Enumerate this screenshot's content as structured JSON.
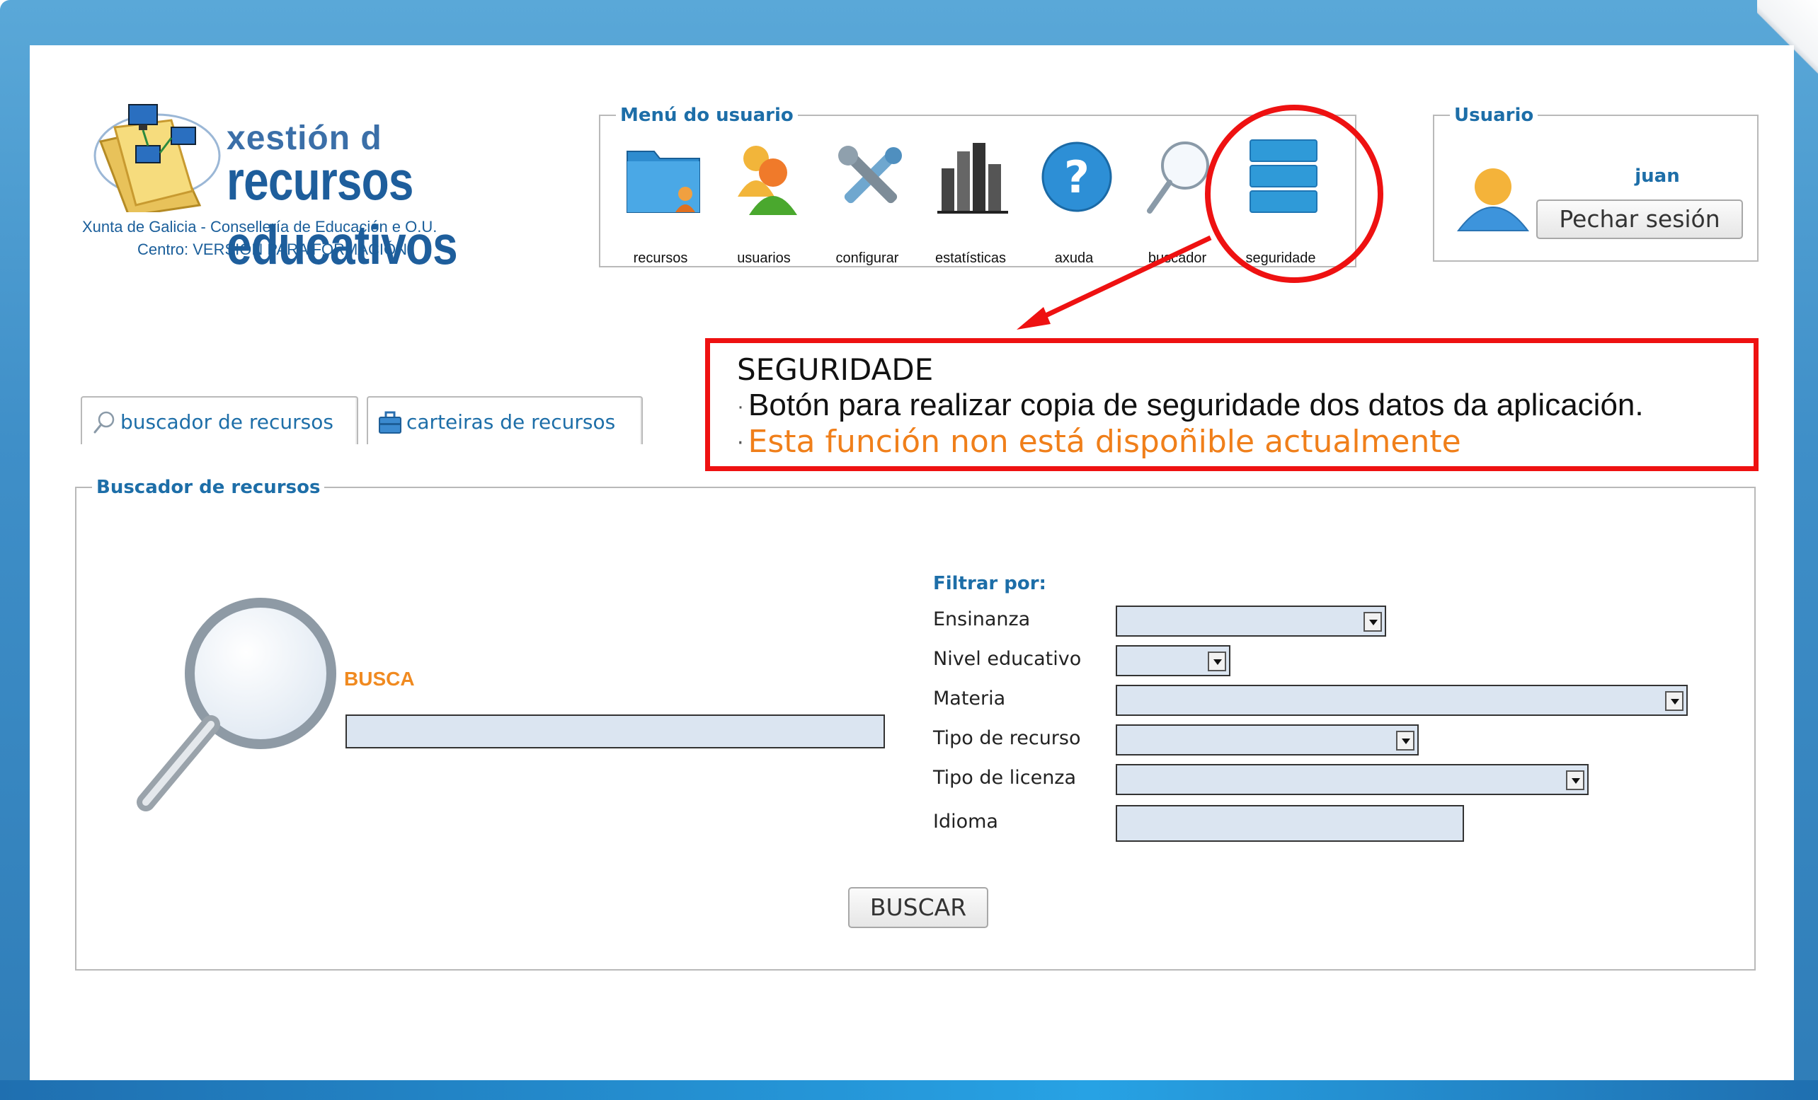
{
  "colors": {
    "accent_blue": "#1d6ea8",
    "annotation_red": "#ee1111",
    "annotation_orange": "#f07f1a",
    "busca_orange": "#f08a20",
    "field_fill": "#dbe5f1"
  },
  "logo": {
    "line1": "xestión d",
    "line2": "recursos educativos",
    "org": "Xunta de Galicia - Consellería de Educación e O.U.",
    "centro": "Centro: VERSIÓN PARA FORMACIÓN"
  },
  "menu": {
    "legend": "Menú do usuario",
    "items": [
      {
        "label": "recursos",
        "icon": "folder-user-icon"
      },
      {
        "label": "usuarios",
        "icon": "users-icon"
      },
      {
        "label": "configurar",
        "icon": "tools-icon"
      },
      {
        "label": "estatísticas",
        "icon": "bar-chart-icon"
      },
      {
        "label": "axuda",
        "icon": "help-icon"
      },
      {
        "label": "buscador",
        "icon": "magnifier-icon"
      },
      {
        "label": "seguridade",
        "icon": "database-icon"
      }
    ]
  },
  "user": {
    "legend": "Usuario",
    "name": "juan",
    "logout_label": "Pechar sesión",
    "icon": "user-avatar-icon"
  },
  "annotation": {
    "title": "SEGURIDADE",
    "line1": "Botón para realizar copia de seguridade dos datos da aplicación.",
    "line2": "Esta función non está dispoñible actualmente",
    "bullet": "·"
  },
  "tabs": [
    {
      "label": "buscador de recursos",
      "icon": "search-icon"
    },
    {
      "label": "carteiras de recursos",
      "icon": "briefcase-icon"
    }
  ],
  "search": {
    "legend": "Buscador de recursos",
    "busca_label": "BUSCA",
    "busca_value": "",
    "filter_title": "Filtrar por:",
    "filters": [
      {
        "label": "Ensinanza",
        "value": "",
        "type": "select"
      },
      {
        "label": "Nivel educativo",
        "value": "",
        "type": "select"
      },
      {
        "label": "Materia",
        "value": "",
        "type": "select"
      },
      {
        "label": "Tipo de recurso",
        "value": "",
        "type": "select"
      },
      {
        "label": "Tipo de licenza",
        "value": "",
        "type": "select"
      },
      {
        "label": "Idioma",
        "value": "",
        "type": "text"
      }
    ],
    "submit_label": "BUSCAR"
  }
}
